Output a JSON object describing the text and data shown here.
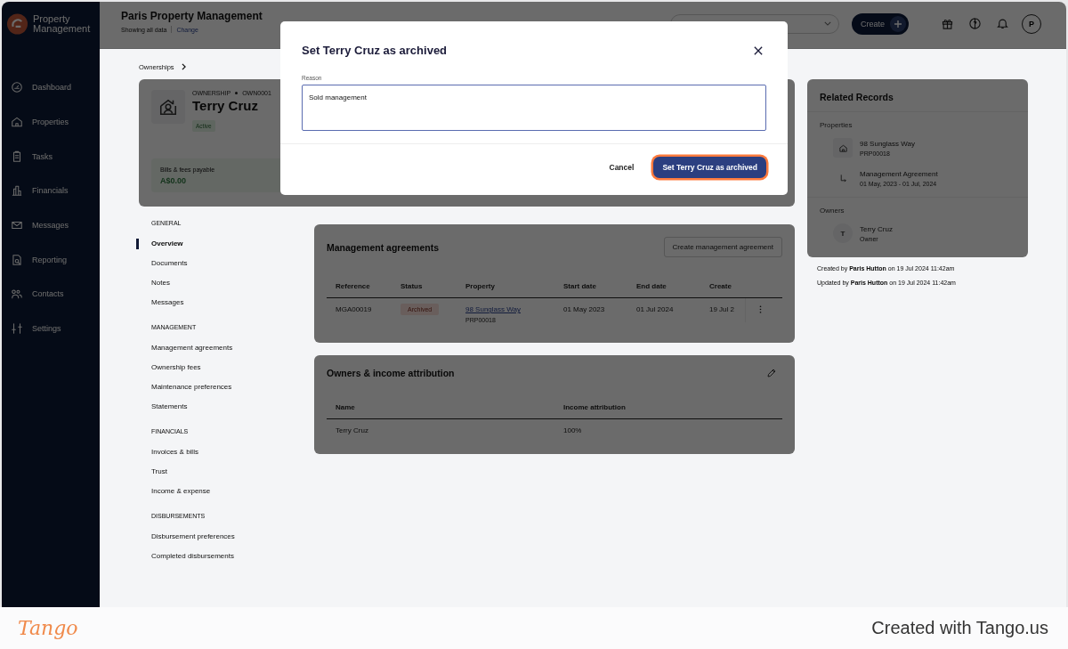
{
  "brand": {
    "name": "Property Management"
  },
  "sidebar": {
    "items": [
      {
        "label": "Dashboard"
      },
      {
        "label": "Properties"
      },
      {
        "label": "Tasks"
      },
      {
        "label": "Financials"
      },
      {
        "label": "Messages"
      },
      {
        "label": "Reporting"
      },
      {
        "label": "Contacts"
      },
      {
        "label": "Settings"
      }
    ]
  },
  "header": {
    "title": "Paris Property Management",
    "subtitle": "Showing all data",
    "link": "Change",
    "create": "Create",
    "avatar": "P"
  },
  "breadcrumb": "Ownerships",
  "ownership": {
    "label": "OWNERSHIP",
    "id": "OWN0001",
    "name": "Terry Cruz",
    "status": "Active",
    "bills_label": "Bills & fees payable",
    "bills_value": "A$0.00"
  },
  "nav": [
    {
      "heading": "GENERAL",
      "items": [
        {
          "label": "Overview",
          "selected": true
        },
        {
          "label": "Documents",
          "selected": false
        },
        {
          "label": "Notes",
          "selected": false
        },
        {
          "label": "Messages",
          "selected": false
        }
      ]
    },
    {
      "heading": "MANAGEMENT",
      "items": [
        {
          "label": "Management agreements",
          "selected": false
        },
        {
          "label": "Ownership fees",
          "selected": false
        },
        {
          "label": "Maintenance preferences",
          "selected": false
        },
        {
          "label": "Statements",
          "selected": false
        }
      ]
    },
    {
      "heading": "FINANCIALS",
      "items": [
        {
          "label": "Invoices & bills",
          "selected": false
        },
        {
          "label": "Trust",
          "selected": false
        },
        {
          "label": "Income & expense",
          "selected": false
        }
      ]
    },
    {
      "heading": "DISBURSEMENTS",
      "items": [
        {
          "label": "Disbursement preferences",
          "selected": false
        },
        {
          "label": "Completed disbursements",
          "selected": false
        }
      ]
    }
  ],
  "agreements": {
    "title": "Management agreements",
    "button": "Create management agreement",
    "columns": [
      "Reference",
      "Status",
      "Property",
      "Start date",
      "End date",
      "Create"
    ],
    "rows": [
      {
        "reference": "MGA00019",
        "status": "Archived",
        "property": "98 Sunglass Way",
        "property_id": "PRP00018",
        "start": "01 May 2023",
        "end": "01 Jul 2024",
        "created": "19 Jul 2"
      }
    ]
  },
  "owners": {
    "title": "Owners & income attribution",
    "columns": [
      "Name",
      "Income attribution"
    ],
    "rows": [
      {
        "name": "Terry Cruz",
        "attribution": "100%"
      }
    ]
  },
  "related": {
    "title": "Related Records",
    "properties_heading": "Properties",
    "properties": [
      {
        "kind": "property",
        "title": "98 Sunglass Way",
        "subtitle": "PRP00018"
      },
      {
        "kind": "agreement",
        "title": "Management Agreement",
        "subtitle": "01 May, 2023 - 01 Jul, 2024"
      }
    ],
    "owners_heading": "Owners",
    "owners": [
      {
        "initial": "T",
        "name": "Terry Cruz",
        "role": "Owner"
      }
    ]
  },
  "audit": [
    "Created by **Paris Hutton** on 19 Jul 2024 11:42am",
    "Updated by **Paris Hutton** on 19 Jul 2024 11:42am"
  ],
  "modal": {
    "title": "Set Terry Cruz as archived",
    "field_label": "Reason",
    "value": "Sold management",
    "cancel": "Cancel",
    "confirm": "Set Terry Cruz as archived"
  },
  "footer": {
    "logo": "Tango",
    "text": "Created with Tango.us"
  }
}
